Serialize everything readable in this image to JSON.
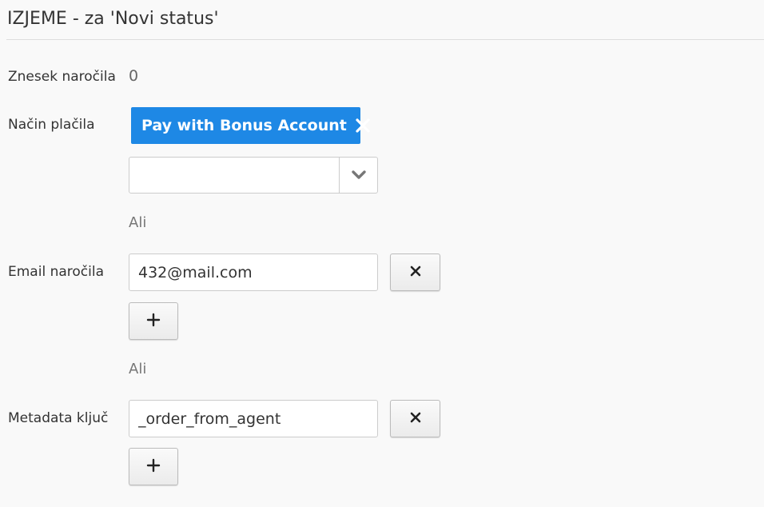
{
  "header": {
    "title": "IZJEME - za 'Novi status'"
  },
  "order_amount": {
    "label": "Znesek naročila",
    "value": "0"
  },
  "payment_method": {
    "label": "Način plačila",
    "selected_chip": "Pay with Bonus Account",
    "select_value": ""
  },
  "separator_1": "Ali",
  "order_email": {
    "label": "Email naročila",
    "value": "432@mail.com"
  },
  "separator_2": "Ali",
  "metadata_key": {
    "label": "Metadata ključ",
    "value": "_order_from_agent"
  },
  "icons": {
    "chip_remove": "close-icon",
    "select_toggle": "chevron-down-icon",
    "remove_button": "close-icon",
    "add_button": "plus-icon"
  },
  "colors": {
    "chip_background": "#1e88e5",
    "page_background": "#f9f9f9"
  }
}
